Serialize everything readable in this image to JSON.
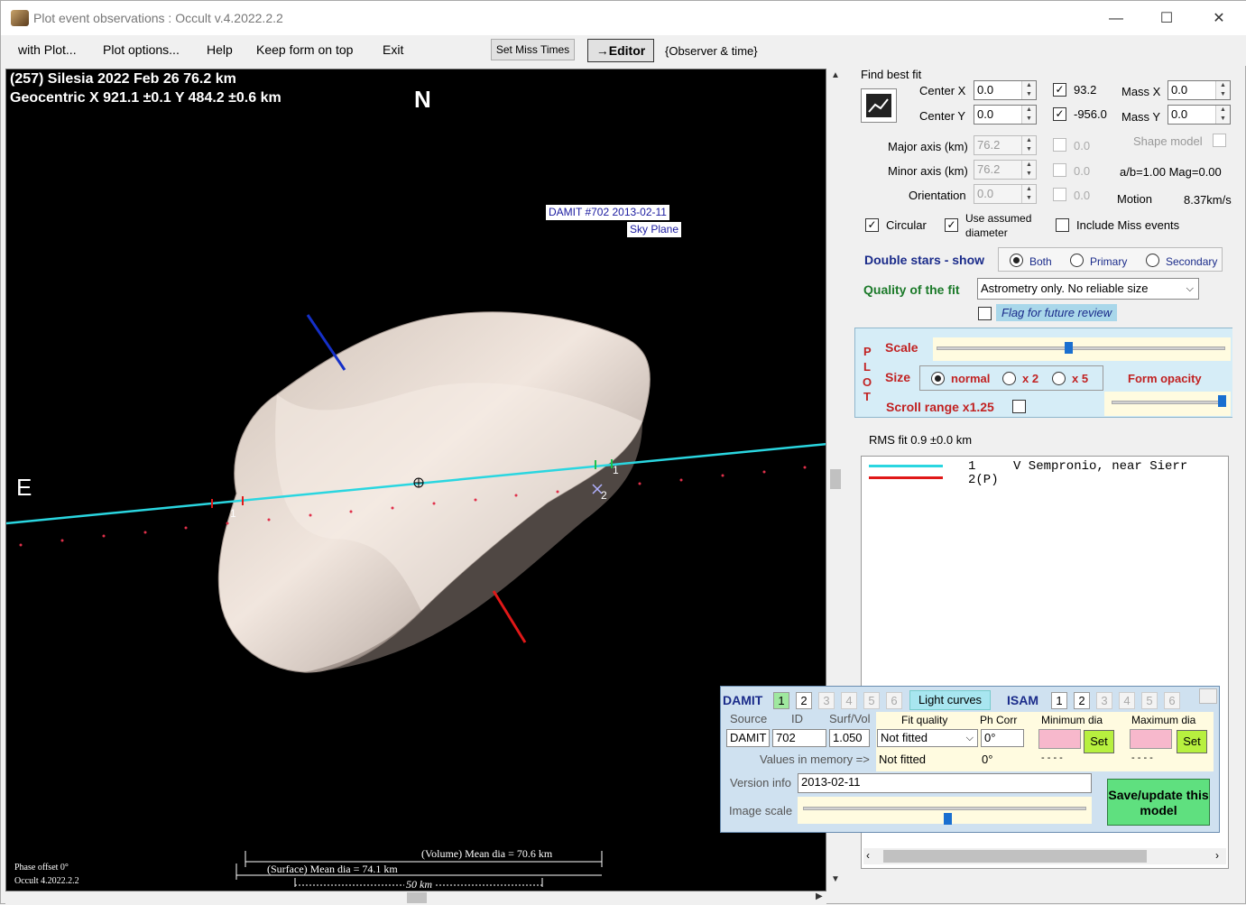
{
  "window": {
    "title": "Plot event observations : Occult v.4.2022.2.2",
    "minimize": "—",
    "maximize": "☐",
    "close": "✕"
  },
  "menu": {
    "items": [
      "with Plot...",
      "Plot options...",
      "Help",
      "Keep form on top",
      "Exit"
    ],
    "set_miss_times": "Set Miss Times",
    "editor": "→Editor",
    "observer_time": "{Observer & time}"
  },
  "plot": {
    "title_line1": "(257) Silesia  2022 Feb 26   76.2 km",
    "title_line2": "Geocentric  X  921.1 ±0.1  Y 484.2 ±0.6 km",
    "north": "N",
    "east": "E",
    "damit_label": "DAMIT #702 2013-02-11",
    "sky_plane": "Sky Plane",
    "chord1_start": "1",
    "chord1_end": "1",
    "chord2_end": "2",
    "volume_dia": "(Volume) Mean dia = 70.6 km",
    "surface_dia": "(Surface) Mean dia = 74.1 km",
    "scale_bar": "50 km",
    "phase_offset": "Phase offset 0°",
    "version": "Occult 4.2022.2.2",
    "colors": {
      "chord1": "#2ad6e0",
      "chord2_points": "#e0304a",
      "north_pole": "#1530c8",
      "south_pole": "#e01818"
    }
  },
  "fit": {
    "find_best_fit": "Find best fit",
    "center_x_label": "Center X",
    "center_x": "0.0",
    "center_y_label": "Center Y",
    "center_y": "0.0",
    "val_93": "93.2",
    "val_956": "-956.0",
    "mass_x_label": "Mass X",
    "mass_x": "0.0",
    "mass_y_label": "Mass Y",
    "mass_y": "0.0",
    "major_label": "Major axis (km)",
    "major": "76.2",
    "minor_label": "Minor axis (km)",
    "minor": "76.2",
    "orient_label": "Orientation",
    "orient": "0.0",
    "dis1": "0.0",
    "dis2": "0.0",
    "dis3": "0.0",
    "shape_model": "Shape model",
    "ab_mag": "a/b=1.00  Mag=0.00",
    "motion_label": "Motion",
    "motion": "8.37km/s, .",
    "circular": "Circular",
    "use_assumed_1": "Use assumed",
    "use_assumed_2": "diameter",
    "include_miss": "Include Miss events",
    "double_stars": "Double stars - show",
    "both": "Both",
    "primary": "Primary",
    "secondary": "Secondary",
    "quality_label": "Quality of the fit",
    "quality": "Astrometry only. No reliable size",
    "flag_review": "Flag for future review"
  },
  "plotpanel": {
    "letters": [
      "P",
      "L",
      "O",
      "T"
    ],
    "scale": "Scale",
    "size": "Size",
    "normal": "normal",
    "x2": "x 2",
    "x5": "x 5",
    "form_opacity": "Form opacity",
    "scroll_range": "Scroll range x1.25"
  },
  "rms": {
    "label": "RMS fit 0.9 ±0.0 km",
    "rows": [
      {
        "num": "1",
        "text": "V Sempronio, near Sierr"
      },
      {
        "num": "2(P)",
        "text": ""
      }
    ]
  },
  "damit": {
    "damit": "DAMIT",
    "isam": "ISAM",
    "damit_nums": [
      "1",
      "2",
      "3",
      "4",
      "5",
      "6"
    ],
    "isam_nums": [
      "1",
      "2",
      "3",
      "4",
      "5",
      "6"
    ],
    "light_curves": "Light curves",
    "source_h": "Source",
    "id_h": "ID",
    "surfvol_h": "Surf/Vol",
    "source": "DAMIT",
    "id": "702",
    "surfvol": "1.050",
    "values_mem": "Values in memory =>",
    "fit_quality_h": "Fit quality",
    "ph_corr_h": "Ph Corr",
    "min_dia_h": "Minimum dia",
    "max_dia_h": "Maximum dia",
    "fit_quality": "Not fitted",
    "ph_corr": "0°",
    "fit_quality_mem": "Not fitted",
    "ph_corr_mem": "0°",
    "dashes1": "- - - -",
    "dashes2": "- - - -",
    "set": "Set",
    "version_label": "Version info",
    "version": "2013-02-11",
    "image_scale": "Image scale",
    "save": "Save/update this model"
  }
}
